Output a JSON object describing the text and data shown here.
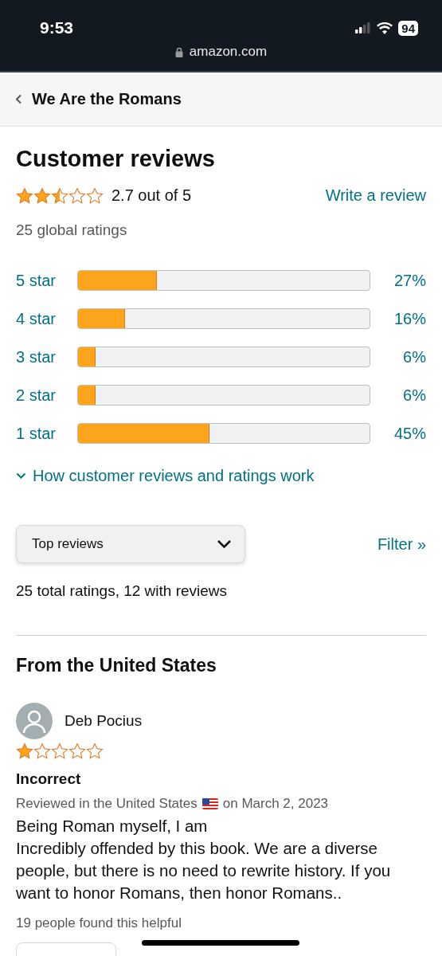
{
  "status_bar": {
    "time": "9:53",
    "battery": "94",
    "url": "amazon.com"
  },
  "header": {
    "title": "We Are the Romans"
  },
  "summary": {
    "heading": "Customer reviews",
    "stars": 2.5,
    "rating": "2.7 out of 5",
    "write_review": "Write a review",
    "global_ratings": "25 global ratings"
  },
  "histogram": [
    {
      "label": "5 star",
      "level": 0.27,
      "percent": "27%"
    },
    {
      "label": "4 star",
      "level": 0.16,
      "percent": "16%"
    },
    {
      "label": "3 star",
      "level": 0.06,
      "percent": "6%"
    },
    {
      "label": "2 star",
      "level": 0.06,
      "percent": "6%"
    },
    {
      "label": "1 star",
      "level": 0.45,
      "percent": "45%"
    }
  ],
  "how_link": "How customer reviews and ratings work",
  "sort": {
    "value": "Top reviews",
    "filter": "Filter »"
  },
  "total": "25 total ratings, 12 with reviews",
  "section_title": "From the United States",
  "reviews": [
    {
      "author": "Deb Pocius",
      "stars": 1,
      "title": "Incorrect",
      "meta_before": "Reviewed in the United States",
      "meta_after": "on March 2, 2023",
      "body_lines": [
        "Being Roman myself, I am",
        "Incredibly offended by this book. We are a diverse people, but there is no need to rewrite history. If you want to honor Romans, then honor Romans.."
      ],
      "helpful": "19 people found this helpful"
    }
  ]
}
